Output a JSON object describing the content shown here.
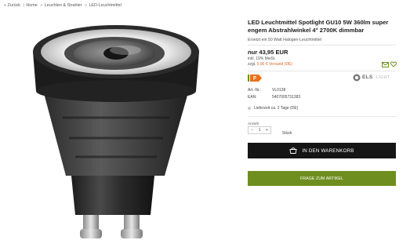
{
  "breadcrumb": {
    "back": "« Zurück",
    "separator_pipe": "|",
    "home": "Home",
    "separator": "»",
    "category": "Leuchten & Strahler",
    "subcategory": "LED-Leuchtmittel"
  },
  "product": {
    "title": "LED Leuchtmittel Spotlight GU10 5W 360lm super engem Abstrahlwinkel 4° 2700K dimmbar",
    "subtitle": "Ersetzt ein 50 Watt Halogen-Leuchtmittel",
    "price": "nur 43,95 EUR",
    "vat": "inkl. 19% MwSt.",
    "shipping_prefix": "zzgl. ",
    "shipping_link": "5,90 € Versand (DE)",
    "energy_class": "F",
    "brand_name": "ELS",
    "brand_suffix": "LIGHT",
    "article_label": "Art.-Nr.:",
    "article_value": "VL0138",
    "ean_label": "EAN:",
    "ean_value": "5407005731383",
    "delivery": "Lieferzeit ca. 2 Tage (DE)"
  },
  "quantity": {
    "label": "Anzahl",
    "minus": "−",
    "value": "1",
    "plus": "+",
    "unit": "Stück"
  },
  "actions": {
    "cart_label": "IN DEN WARENKORB",
    "ask_label": "FRAGE ZUM ARTIKEL"
  },
  "icons": {
    "bag": "shopping-bag-icon",
    "email": "envelope-icon",
    "wishlist": "heart-icon",
    "energy": "energy-label-icon"
  },
  "colors": {
    "cart_button": "#151515",
    "ask_button": "#6e8f1f",
    "shipping_link": "#e0632a",
    "energy_label": "#e8711e",
    "icon_green": "#6e8f1f"
  }
}
